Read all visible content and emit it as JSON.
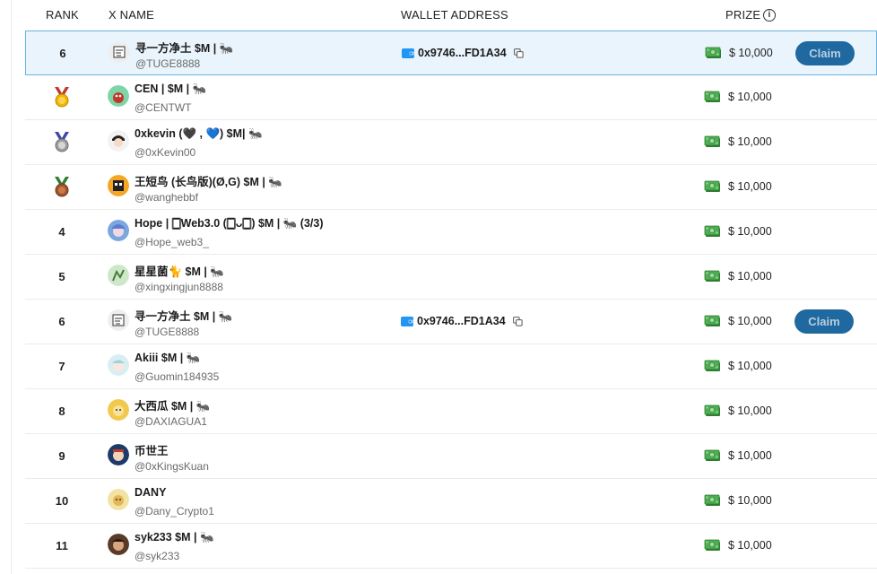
{
  "header": {
    "rank": "RANK",
    "x_name": "X NAME",
    "wallet_address": "WALLET ADDRESS",
    "prize": "PRIZE",
    "prize_info": "i"
  },
  "colors": {
    "accent": "#1f69a0",
    "highlight_bg": "#e9f4fc",
    "highlight_border": "#69b4e3"
  },
  "rows": [
    {
      "rank": "6",
      "name": "寻一方净土 $M | 🐜",
      "handle": "@TUGE8888",
      "wallet": "0x9746...FD1A34",
      "prize": "$ 10,000",
      "claim": "Claim"
    },
    {
      "rank": "",
      "name": "CEN | $M | 🐜",
      "handle": "@CENTWT",
      "prize": "$ 10,000"
    },
    {
      "rank": "",
      "name": "0xkevin (🖤 , 💙) $M| 🐜",
      "handle": "@0xKevin00",
      "prize": "$ 10,000"
    },
    {
      "rank": "",
      "name": "王短鸟 (长鸟版)(Ø,G) $M | 🐜",
      "handle": "@wanghebbf",
      "prize": "$ 10,000"
    },
    {
      "rank": "4",
      "name": "Hope | 🀆Web3.0 (🀆ᴗ🀆) $M | 🐜 (3/3)",
      "handle": "@Hope_web3_",
      "prize": "$ 10,000"
    },
    {
      "rank": "5",
      "name": "星星菌🐈 $M | 🐜",
      "handle": "@xingxingjun8888",
      "prize": "$ 10,000"
    },
    {
      "rank": "6",
      "name": "寻一方净土 $M | 🐜",
      "handle": "@TUGE8888",
      "wallet": "0x9746...FD1A34",
      "prize": "$ 10,000",
      "claim": "Claim"
    },
    {
      "rank": "7",
      "name": "Akiii $M | 🐜",
      "handle": "@Guomin184935",
      "prize": "$ 10,000"
    },
    {
      "rank": "8",
      "name": "大西瓜 $M | 🐜",
      "handle": "@DAXIAGUA1",
      "prize": "$ 10,000"
    },
    {
      "rank": "9",
      "name": "币世王",
      "handle": "@0xKingsKuan",
      "prize": "$ 10,000"
    },
    {
      "rank": "10",
      "name": "DANY",
      "handle": "@Dany_Crypto1",
      "prize": "$ 10,000"
    },
    {
      "rank": "11",
      "name": "syk233 $M | 🐜",
      "handle": "@syk233",
      "prize": "$ 10,000"
    }
  ]
}
